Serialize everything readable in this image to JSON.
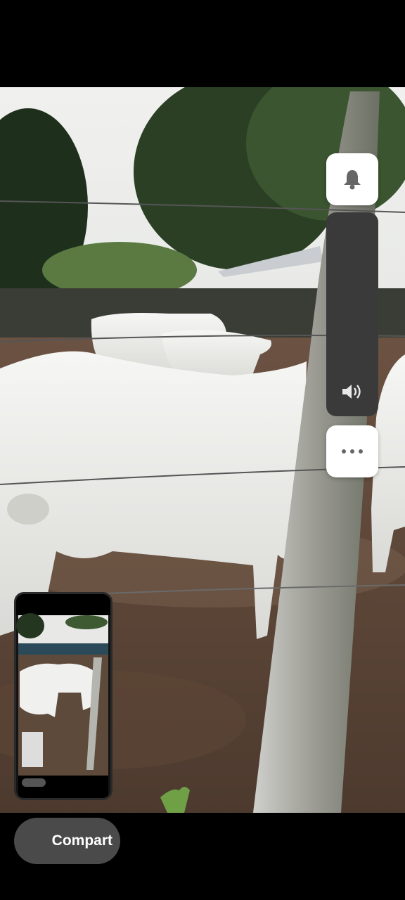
{
  "screenshot_preview": {
    "share_label": "Compart"
  },
  "controls": {
    "ring_icon": "bell-icon",
    "volume_icon": "speaker-icon",
    "more_icon": "more-horizontal-icon"
  },
  "colors": {
    "button_bg": "#ffffff",
    "slider_bg": "#3a3a3a",
    "share_bg": "#4a4a4a",
    "icon": "#666666"
  }
}
